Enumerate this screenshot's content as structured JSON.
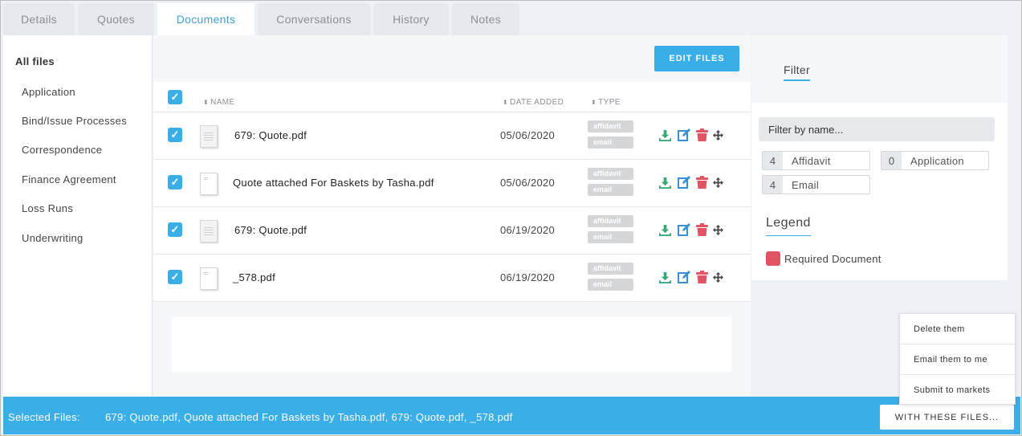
{
  "tabs": [
    {
      "label": "Details",
      "active": false
    },
    {
      "label": "Quotes",
      "active": false
    },
    {
      "label": "Documents",
      "active": true
    },
    {
      "label": "Conversations",
      "active": false
    },
    {
      "label": "History",
      "active": false
    },
    {
      "label": "Notes",
      "active": false
    }
  ],
  "sidebar": {
    "all_files": "All files",
    "items": [
      "Application",
      "Bind/Issue Processes",
      "Correspondence",
      "Finance Agreement",
      "Loss Runs",
      "Underwriting"
    ]
  },
  "toolbar": {
    "edit_files_label": "EDIT FILES"
  },
  "table": {
    "select_all_checked": true,
    "columns": {
      "name": "NAME",
      "date_added": "DATE ADDED",
      "type": "TYPE"
    },
    "rows": [
      {
        "checked": true,
        "name": "679: Quote.pdf",
        "date": "05/06/2020",
        "tags": [
          "affidavit",
          "email"
        ],
        "thumb": "document-icon"
      },
      {
        "checked": true,
        "name": "Quote attached For Baskets by Tasha.pdf",
        "date": "05/06/2020",
        "tags": [
          "affidavit",
          "email"
        ],
        "thumb": "blank-document-icon"
      },
      {
        "checked": true,
        "name": "679: Quote.pdf",
        "date": "06/19/2020",
        "tags": [
          "affidavit",
          "email"
        ],
        "thumb": "document-icon"
      },
      {
        "checked": true,
        "name": "_578.pdf",
        "date": "06/19/2020",
        "tags": [
          "affidavit",
          "email"
        ],
        "thumb": "blank-document-icon"
      }
    ],
    "actions": [
      "download-icon",
      "edit-icon",
      "trash-icon",
      "move-icon"
    ]
  },
  "filter": {
    "tab_label": "Filter",
    "placeholder": "Filter by name...",
    "chips": [
      {
        "count": "4",
        "label": "Affidavit"
      },
      {
        "count": "0",
        "label": "Application"
      },
      {
        "count": "4",
        "label": "Email"
      }
    ]
  },
  "legend": {
    "title": "Legend",
    "items": [
      {
        "label": "Required Document",
        "color": "#e05463"
      }
    ]
  },
  "dropdown": {
    "items": [
      "Delete them",
      "Email them to me",
      "Submit to markets"
    ]
  },
  "bottom_bar": {
    "label": "Selected Files:",
    "files": "679: Quote.pdf, Quote attached For Baskets by Tasha.pdf, 679: Quote.pdf, _578.pdf",
    "button_label": "WITH THESE FILES..."
  },
  "colors": {
    "accent": "#3aaee6",
    "download": "#3aa878",
    "edit": "#3a8fd0",
    "delete": "#e05463",
    "tag": "#d4d6d8"
  }
}
